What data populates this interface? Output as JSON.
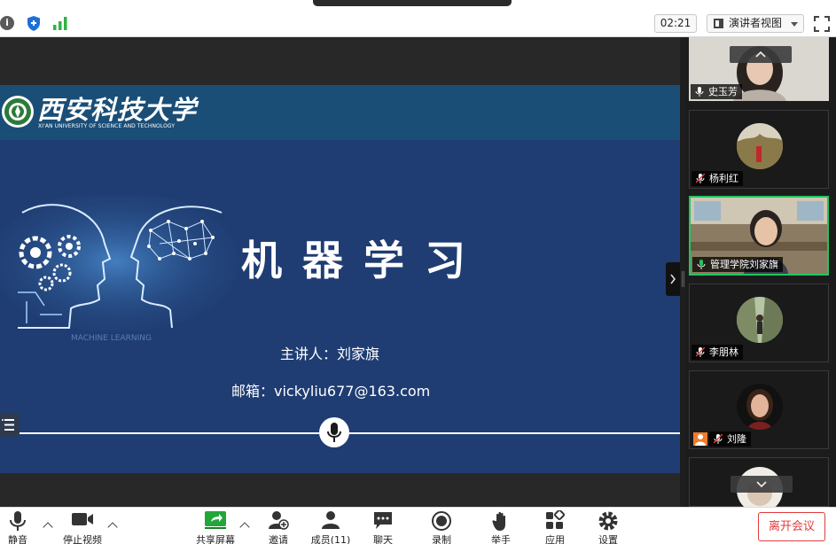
{
  "topbar": {
    "timer": "02:21",
    "view_mode": "演讲者视图"
  },
  "slide": {
    "university_cn": "西安科技大学",
    "university_en": "XI'AN UNIVERSITY OF SCIENCE AND TECHNOLOGY",
    "title": "机器学习",
    "art_caption": "MACHINE LEARNING",
    "presenter": "主讲人：刘家旗",
    "email": "邮箱：vickyliu677@163.com"
  },
  "participants": [
    {
      "name": "史玉芳",
      "muted": false
    },
    {
      "name": "杨利红",
      "muted": true
    },
    {
      "name": "管理学院刘家旗",
      "muted": false,
      "active": true
    },
    {
      "name": "李朋林",
      "muted": true
    },
    {
      "name": "刘隆",
      "muted": true
    }
  ],
  "toolbar": {
    "mute": "静音",
    "stop_video": "停止视频",
    "share_screen": "共享屏幕",
    "invite": "邀请",
    "members": "成员(11)",
    "chat": "聊天",
    "record": "录制",
    "raise_hand": "举手",
    "apps": "应用",
    "settings": "设置",
    "leave": "离开会议"
  },
  "colors": {
    "slide_bg": "#1f3d73",
    "active_border": "#22c55e",
    "leave_red": "#e23b3b",
    "share_green": "#22a63a"
  }
}
